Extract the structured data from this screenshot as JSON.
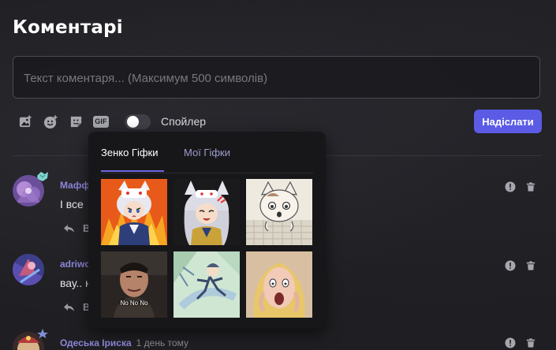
{
  "page": {
    "title": "Коментарі"
  },
  "composer": {
    "placeholder": "Текст коментаря... (Максимум 500 символів)",
    "spoiler_label": "Спойлер",
    "spoiler_enabled": false,
    "send_label": "Надіслати",
    "tools": [
      "image-icon",
      "emoji-icon",
      "sticker-icon",
      "gif-icon"
    ],
    "gif_label": "GIF"
  },
  "gif_picker": {
    "tabs": [
      {
        "label": "Зенко Гіфки",
        "active": true
      },
      {
        "label": "Мої Гіфки",
        "active": false
      }
    ],
    "items": [
      {
        "name": "angry-fox-girl-fire-gif",
        "caption": ""
      },
      {
        "name": "angry-fox-girl-gif",
        "caption": ""
      },
      {
        "name": "cat-keyboard-gif",
        "caption": ""
      },
      {
        "name": "no-no-no-gif",
        "caption": "No No No"
      },
      {
        "name": "anime-running-gif",
        "caption": ""
      },
      {
        "name": "shocked-blonde-gif",
        "caption": ""
      }
    ]
  },
  "comments": [
    {
      "author": "Мафф",
      "time": "",
      "text": "І все",
      "reply_label": "В"
    },
    {
      "author": "adriwo",
      "time": "",
      "text": "вау.. н",
      "reply_label": "В"
    },
    {
      "author": "Одеська Іриска",
      "time": "1 день тому",
      "text": "",
      "reply_label": ""
    }
  ],
  "colors": {
    "accent": "#5b5be6",
    "author": "#8d86d8",
    "background": "#1f1f23",
    "popup": "#17171a"
  }
}
